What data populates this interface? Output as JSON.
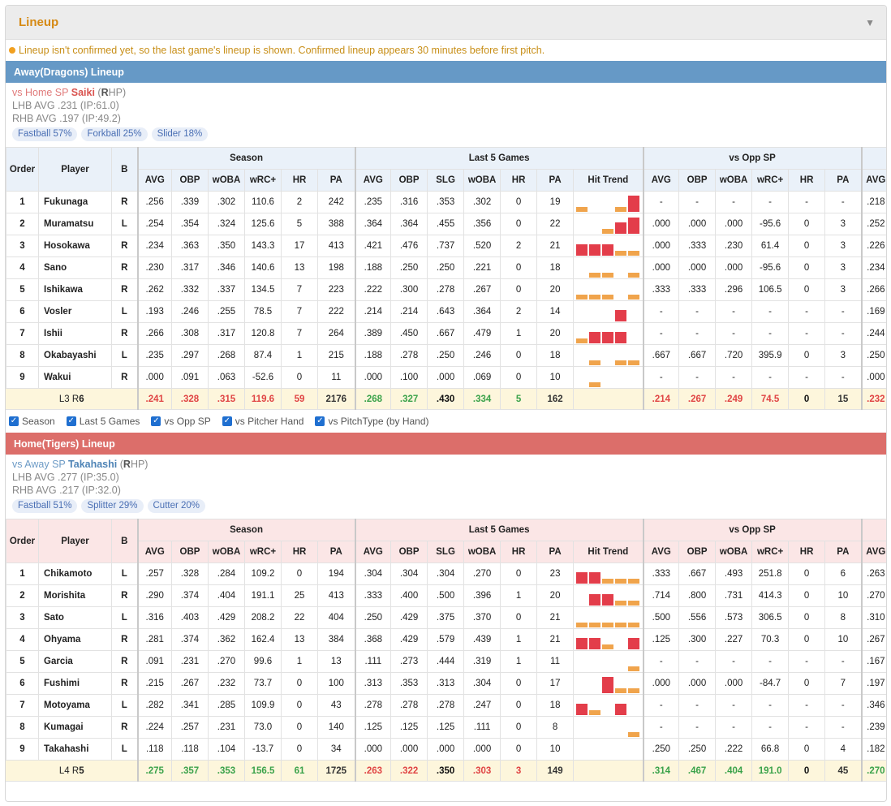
{
  "header": {
    "title": "Lineup",
    "collapse_icon": "triangle-down-icon"
  },
  "notice": "Lineup isn't confirmed yet, so the last game's lineup is shown. Confirmed lineup appears 30 minutes before first pitch.",
  "headers": {
    "order": "Order",
    "player": "Player",
    "bat": "B",
    "groups": [
      "Season",
      "Last 5 Games",
      "vs Opp SP"
    ],
    "season_cols": [
      "AVG",
      "OBP",
      "wOBA",
      "wRC+",
      "HR",
      "PA"
    ],
    "last5_cols": [
      "AVG",
      "OBP",
      "SLG",
      "wOBA",
      "HR",
      "PA",
      "Hit Trend"
    ],
    "opp_cols": [
      "AVG",
      "OBP",
      "wOBA",
      "wRC+",
      "HR",
      "PA",
      "AVG"
    ]
  },
  "options": [
    "Season",
    "Last 5 Games",
    "vs Opp SP",
    "vs Pitcher Hand",
    "vs PitchType (by Hand)"
  ],
  "teams": [
    {
      "title": "Away(Dragons) Lineup",
      "vs_prefix": "vs Home SP",
      "sp": "Saiki",
      "hand_open": "(",
      "hand_letter": "R",
      "hand_rest": "HP)",
      "lhb": "LHB AVG .231 (IP:61.0)",
      "rhb": "RHB AVG .197 (IP:49.2)",
      "pitches": [
        "Fastball 57%",
        "Forkball 25%",
        "Slider 18%"
      ],
      "rows": [
        {
          "o": "1",
          "name": "Fukunaga",
          "b": "R",
          "season": [
            ".256",
            ".339",
            ".302",
            "110.6",
            "2",
            "242"
          ],
          "last5": [
            ".235",
            ".316",
            ".353",
            ".302",
            "0",
            "19"
          ],
          "trend": [
            1,
            0,
            0,
            1,
            3
          ],
          "opp": [
            "-",
            "-",
            "-",
            "-",
            "-",
            "-",
            ".218"
          ]
        },
        {
          "o": "2",
          "name": "Muramatsu",
          "b": "L",
          "season": [
            ".254",
            ".354",
            ".324",
            "125.6",
            "5",
            "388"
          ],
          "last5": [
            ".364",
            ".364",
            ".455",
            ".356",
            "0",
            "22"
          ],
          "trend": [
            0,
            0,
            1,
            2,
            3
          ],
          "opp": [
            ".000",
            ".000",
            ".000",
            "-95.6",
            "0",
            "3",
            ".252"
          ]
        },
        {
          "o": "3",
          "name": "Hosokawa",
          "b": "R",
          "season": [
            ".234",
            ".363",
            ".350",
            "143.3",
            "17",
            "413"
          ],
          "last5": [
            ".421",
            ".476",
            ".737",
            ".520",
            "2",
            "21"
          ],
          "trend": [
            2,
            2,
            2,
            1,
            1
          ],
          "opp": [
            ".000",
            ".333",
            ".230",
            "61.4",
            "0",
            "3",
            ".226"
          ]
        },
        {
          "o": "4",
          "name": "Sano",
          "b": "R",
          "season": [
            ".230",
            ".317",
            ".346",
            "140.6",
            "13",
            "198"
          ],
          "last5": [
            ".188",
            ".250",
            ".250",
            ".221",
            "0",
            "18"
          ],
          "trend": [
            0,
            1,
            1,
            0,
            1
          ],
          "opp": [
            ".000",
            ".000",
            ".000",
            "-95.6",
            "0",
            "3",
            ".234"
          ]
        },
        {
          "o": "5",
          "name": "Ishikawa",
          "b": "R",
          "season": [
            ".262",
            ".332",
            ".337",
            "134.5",
            "7",
            "223"
          ],
          "last5": [
            ".222",
            ".300",
            ".278",
            ".267",
            "0",
            "20"
          ],
          "trend": [
            1,
            1,
            1,
            0,
            1
          ],
          "opp": [
            ".333",
            ".333",
            ".296",
            "106.5",
            "0",
            "3",
            ".266"
          ]
        },
        {
          "o": "6",
          "name": "Vosler",
          "b": "L",
          "season": [
            ".193",
            ".246",
            ".255",
            "78.5",
            "7",
            "222"
          ],
          "last5": [
            ".214",
            ".214",
            ".643",
            ".364",
            "2",
            "14"
          ],
          "trend": [
            0,
            0,
            0,
            2,
            0
          ],
          "opp": [
            "-",
            "-",
            "-",
            "-",
            "-",
            "-",
            ".169"
          ]
        },
        {
          "o": "7",
          "name": "Ishii",
          "b": "R",
          "season": [
            ".266",
            ".308",
            ".317",
            "120.8",
            "7",
            "264"
          ],
          "last5": [
            ".389",
            ".450",
            ".667",
            ".479",
            "1",
            "20"
          ],
          "trend": [
            1,
            2,
            2,
            2,
            0
          ],
          "opp": [
            "-",
            "-",
            "-",
            "-",
            "-",
            "-",
            ".244"
          ]
        },
        {
          "o": "8",
          "name": "Okabayashi",
          "b": "L",
          "season": [
            ".235",
            ".297",
            ".268",
            "87.4",
            "1",
            "215"
          ],
          "last5": [
            ".188",
            ".278",
            ".250",
            ".246",
            "0",
            "18"
          ],
          "trend": [
            0,
            1,
            0,
            1,
            1
          ],
          "opp": [
            ".667",
            ".667",
            ".720",
            "395.9",
            "0",
            "3",
            ".250"
          ]
        },
        {
          "o": "9",
          "name": "Wakui",
          "b": "R",
          "season": [
            ".000",
            ".091",
            ".063",
            "-52.6",
            "0",
            "11"
          ],
          "last5": [
            ".000",
            ".100",
            ".000",
            ".069",
            "0",
            "10"
          ],
          "trend": [
            0,
            1,
            0,
            0,
            0
          ],
          "opp": [
            "-",
            "-",
            "-",
            "-",
            "-",
            "-",
            ".000"
          ]
        }
      ],
      "summary": {
        "label_prefix": "L3 R",
        "label_num": "6",
        "season": [
          ".241",
          ".328",
          ".315",
          "119.6",
          "59",
          "2176"
        ],
        "season_colors": [
          "c-red",
          "c-red",
          "c-red",
          "c-red",
          "c-red",
          "c-normal"
        ],
        "last5": [
          ".268",
          ".327",
          ".430",
          ".334",
          "5",
          "162"
        ],
        "last5_colors": [
          "c-green",
          "c-green",
          "c-black",
          "c-green",
          "c-green",
          "c-normal"
        ],
        "opp": [
          ".214",
          ".267",
          ".249",
          "74.5",
          "0",
          "15",
          ".232"
        ],
        "opp_colors": [
          "c-red",
          "c-red",
          "c-red",
          "c-red",
          "c-black",
          "c-normal",
          "c-red"
        ]
      }
    },
    {
      "title": "Home(Tigers) Lineup",
      "vs_prefix": "vs Away SP",
      "sp": "Takahashi",
      "hand_open": "(",
      "hand_letter": "R",
      "hand_rest": "HP)",
      "lhb": "LHB AVG .277 (IP:35.0)",
      "rhb": "RHB AVG .217 (IP:32.0)",
      "pitches": [
        "Fastball 51%",
        "Splitter 29%",
        "Cutter 20%"
      ],
      "rows": [
        {
          "o": "1",
          "name": "Chikamoto",
          "b": "L",
          "season": [
            ".257",
            ".328",
            ".284",
            "109.2",
            "0",
            "194"
          ],
          "last5": [
            ".304",
            ".304",
            ".304",
            ".270",
            "0",
            "23"
          ],
          "trend": [
            2,
            2,
            1,
            1,
            1
          ],
          "opp": [
            ".333",
            ".667",
            ".493",
            "251.8",
            "0",
            "6",
            ".263"
          ]
        },
        {
          "o": "2",
          "name": "Morishita",
          "b": "R",
          "season": [
            ".290",
            ".374",
            ".404",
            "191.1",
            "25",
            "413"
          ],
          "last5": [
            ".333",
            ".400",
            ".500",
            ".396",
            "1",
            "20"
          ],
          "trend": [
            0,
            2,
            2,
            1,
            1
          ],
          "opp": [
            ".714",
            ".800",
            ".731",
            "414.3",
            "0",
            "10",
            ".270"
          ]
        },
        {
          "o": "3",
          "name": "Sato",
          "b": "L",
          "season": [
            ".316",
            ".403",
            ".429",
            "208.2",
            "22",
            "404"
          ],
          "last5": [
            ".250",
            ".429",
            ".375",
            ".370",
            "0",
            "21"
          ],
          "trend": [
            1,
            1,
            1,
            1,
            1
          ],
          "opp": [
            ".500",
            ".556",
            ".573",
            "306.5",
            "0",
            "8",
            ".310"
          ]
        },
        {
          "o": "4",
          "name": "Ohyama",
          "b": "R",
          "season": [
            ".281",
            ".374",
            ".362",
            "162.4",
            "13",
            "384"
          ],
          "last5": [
            ".368",
            ".429",
            ".579",
            ".439",
            "1",
            "21"
          ],
          "trend": [
            2,
            2,
            1,
            0,
            2
          ],
          "opp": [
            ".125",
            ".300",
            ".227",
            "70.3",
            "0",
            "10",
            ".267"
          ]
        },
        {
          "o": "5",
          "name": "Garcia",
          "b": "R",
          "season": [
            ".091",
            ".231",
            ".270",
            "99.6",
            "1",
            "13"
          ],
          "last5": [
            ".111",
            ".273",
            ".444",
            ".319",
            "1",
            "11"
          ],
          "trend": [
            0,
            0,
            0,
            0,
            1
          ],
          "opp": [
            "-",
            "-",
            "-",
            "-",
            "-",
            "-",
            ".167"
          ]
        },
        {
          "o": "6",
          "name": "Fushimi",
          "b": "R",
          "season": [
            ".215",
            ".267",
            ".232",
            "73.7",
            "0",
            "100"
          ],
          "last5": [
            ".313",
            ".353",
            ".313",
            ".304",
            "0",
            "17"
          ],
          "trend": [
            0,
            0,
            3,
            1,
            1
          ],
          "opp": [
            ".000",
            ".000",
            ".000",
            "-84.7",
            "0",
            "7",
            ".197"
          ]
        },
        {
          "o": "7",
          "name": "Motoyama",
          "b": "L",
          "season": [
            ".282",
            ".341",
            ".285",
            "109.9",
            "0",
            "43"
          ],
          "last5": [
            ".278",
            ".278",
            ".278",
            ".247",
            "0",
            "18"
          ],
          "trend": [
            2,
            1,
            0,
            2,
            0
          ],
          "opp": [
            "-",
            "-",
            "-",
            "-",
            "-",
            "-",
            ".346"
          ]
        },
        {
          "o": "8",
          "name": "Kumagai",
          "b": "R",
          "season": [
            ".224",
            ".257",
            ".231",
            "73.0",
            "0",
            "140"
          ],
          "last5": [
            ".125",
            ".125",
            ".125",
            ".111",
            "0",
            "8"
          ],
          "trend": [
            0,
            0,
            0,
            0,
            1
          ],
          "opp": [
            "-",
            "-",
            "-",
            "-",
            "-",
            "-",
            ".239"
          ]
        },
        {
          "o": "9",
          "name": "Takahashi",
          "b": "L",
          "season": [
            ".118",
            ".118",
            ".104",
            "-13.7",
            "0",
            "34"
          ],
          "last5": [
            ".000",
            ".000",
            ".000",
            ".000",
            "0",
            "10"
          ],
          "trend": [
            0,
            0,
            0,
            0,
            0
          ],
          "opp": [
            ".250",
            ".250",
            ".222",
            "66.8",
            "0",
            "4",
            ".182"
          ]
        }
      ],
      "summary": {
        "label_prefix": "L4 R",
        "label_num": "5",
        "season": [
          ".275",
          ".357",
          ".353",
          "156.5",
          "61",
          "1725"
        ],
        "season_colors": [
          "c-green",
          "c-green",
          "c-green",
          "c-green",
          "c-green",
          "c-normal"
        ],
        "last5": [
          ".263",
          ".322",
          ".350",
          ".303",
          "3",
          "149"
        ],
        "last5_colors": [
          "c-red",
          "c-red",
          "c-black",
          "c-red",
          "c-red",
          "c-normal"
        ],
        "opp": [
          ".314",
          ".467",
          ".404",
          "191.0",
          "0",
          "45",
          ".270"
        ],
        "opp_colors": [
          "c-green",
          "c-green",
          "c-green",
          "c-green",
          "c-black",
          "c-normal",
          "c-green"
        ]
      }
    }
  ]
}
